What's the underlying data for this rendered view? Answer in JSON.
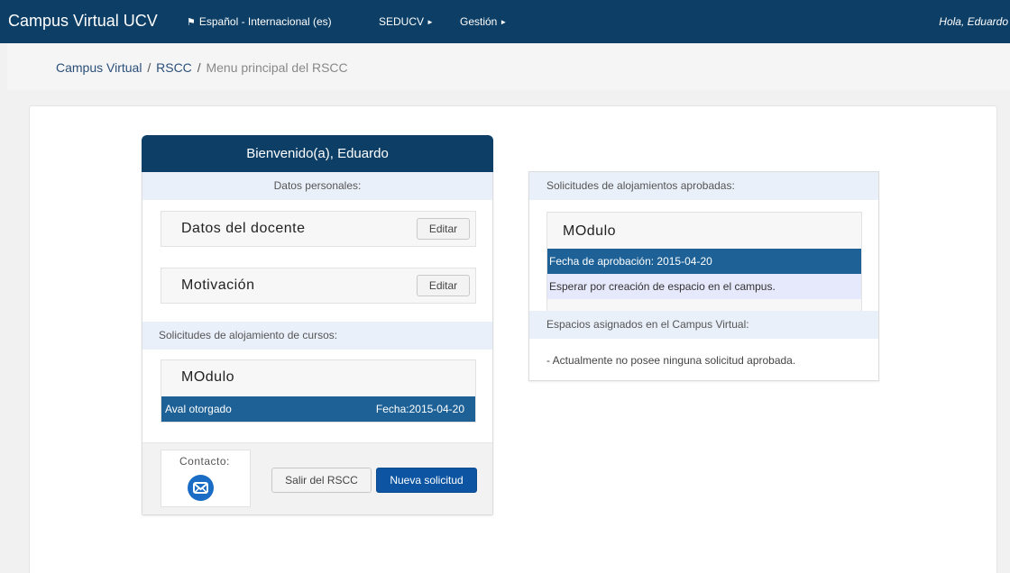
{
  "navbar": {
    "brand": "Campus Virtual UCV",
    "language": "Español - Internacional (es)",
    "menu_seducv": "SEDUCV",
    "menu_gestion": "Gestión",
    "user_greeting": "Hola, Eduardo"
  },
  "breadcrumb": {
    "items": [
      "Campus Virtual",
      "RSCC",
      "Menu principal del RSCC"
    ]
  },
  "left_card": {
    "title": "Bienvenido(a), Eduardo",
    "section_personal": "Datos personales:",
    "rows": [
      {
        "label": "Datos del docente",
        "button": "Editar"
      },
      {
        "label": "Motivación",
        "button": "Editar"
      }
    ],
    "section_solicitudes": "Solicitudes de alojamiento de cursos:",
    "course": {
      "name": "MOdulo",
      "status": "Aval otorgado",
      "date": "Fecha:2015-04-20"
    },
    "footer": {
      "contact_label": "Contacto:",
      "contact_icon": "envelope-icon",
      "btn_salir": "Salir del RSCC",
      "btn_nueva": "Nueva solicitud"
    }
  },
  "right_card": {
    "section_aprobadas": "Solicitudes de alojamientos aprobadas:",
    "approved": {
      "name": "MOdulo",
      "date": "Fecha de aprobación: 2015-04-20",
      "note": "Esperar por creación de espacio en el campus."
    },
    "section_espacios": "Espacios asignados en el Campus Virtual:",
    "empty_message": "- Actualmente no posee ninguna solicitud aprobada."
  },
  "colors": {
    "navbar": "#0c3e66",
    "status_bar": "#1d6197",
    "primary_button": "#0d55a3",
    "section_bg": "#eaf0fa"
  }
}
